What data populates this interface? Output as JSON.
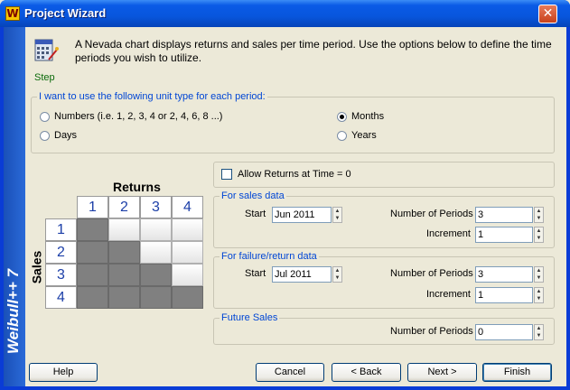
{
  "window": {
    "title": "Project Wizard",
    "app_icon": "W",
    "close_glyph": "✕"
  },
  "sidebar": {
    "text": "Weibull++ 7"
  },
  "header": {
    "step_label": "Step",
    "intro": "A Nevada chart displays returns and sales per time period. Use the options below to define the time periods you wish to utilize."
  },
  "unit_type": {
    "legend": "I want to use the following unit type for each period:",
    "options": [
      {
        "label": "Numbers (i.e. 1, 2, 3, 4 or 2, 4, 6, 8 ...)",
        "selected": false
      },
      {
        "label": "Months",
        "selected": true
      },
      {
        "label": "Days",
        "selected": false
      },
      {
        "label": "Years",
        "selected": false
      }
    ]
  },
  "nevada": {
    "returns_label": "Returns",
    "sales_label": "Sales",
    "columns": [
      "1",
      "2",
      "3",
      "4"
    ],
    "rows": [
      "1",
      "2",
      "3",
      "4"
    ],
    "filled": [
      [
        1,
        0,
        0,
        0
      ],
      [
        1,
        1,
        0,
        0
      ],
      [
        1,
        1,
        1,
        0
      ],
      [
        1,
        1,
        1,
        1
      ]
    ]
  },
  "allow_returns": {
    "label": "Allow Returns at Time = 0",
    "checked": false
  },
  "sales_data": {
    "legend": "For sales data",
    "start_label": "Start",
    "start_value": "Jun 2011",
    "periods_label": "Number of Periods",
    "periods_value": "3",
    "increment_label": "Increment",
    "increment_value": "1"
  },
  "return_data": {
    "legend": "For failure/return data",
    "start_label": "Start",
    "start_value": "Jul 2011",
    "periods_label": "Number of Periods",
    "periods_value": "3",
    "increment_label": "Increment",
    "increment_value": "1"
  },
  "future_sales": {
    "legend": "Future Sales",
    "periods_label": "Number of Periods",
    "periods_value": "0"
  },
  "buttons": {
    "help": "Help",
    "cancel": "Cancel",
    "back": "< Back",
    "next": "Next >",
    "finish": "Finish"
  }
}
